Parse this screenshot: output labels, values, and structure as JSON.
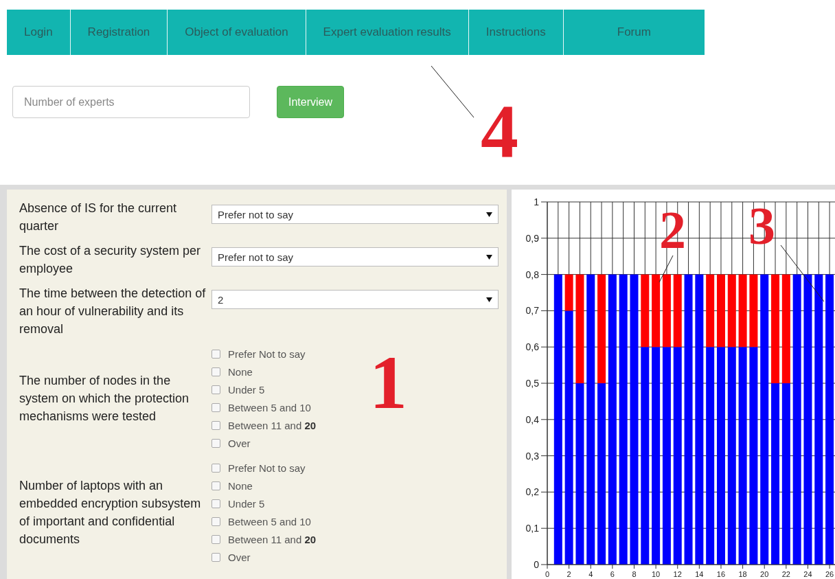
{
  "nav": {
    "tabs": [
      {
        "label": "Login",
        "selected": false
      },
      {
        "label": "Registration",
        "selected": false
      },
      {
        "label": "Object of evaluation",
        "selected": false
      },
      {
        "label": "Expert evaluation results",
        "selected": false
      },
      {
        "label": "Instructions",
        "selected": false
      },
      {
        "label": "Forum",
        "selected": false
      }
    ]
  },
  "experts_field": {
    "placeholder": "Number of experts"
  },
  "interview_button": {
    "label": "Interview"
  },
  "questions": [
    {
      "kind": "select",
      "label": "Absence of IS for the current quarter",
      "value": "Prefer not to say"
    },
    {
      "kind": "select",
      "label": "The cost of a security system per employee",
      "value": "Prefer not to say"
    },
    {
      "kind": "select",
      "label": "The time between the detection of an hour of vulnerability and its removal",
      "value": "2"
    },
    {
      "kind": "checkboxes",
      "label": "The number of nodes in the system on which the protection mechanisms were tested",
      "options": [
        {
          "label": "Prefer Not to say",
          "checked": false
        },
        {
          "label": "None",
          "checked": false
        },
        {
          "label": "Under 5",
          "checked": false
        },
        {
          "label": "Between 5 and 10",
          "checked": false
        },
        {
          "label": "Between 11 and **20**",
          "checked": false
        },
        {
          "label": "Over",
          "checked": false
        }
      ]
    },
    {
      "kind": "checkboxes",
      "label": "Number of laptops with an embedded encryption subsystem of important and confidential documents",
      "options": [
        {
          "label": "Prefer Not to say",
          "checked": false
        },
        {
          "label": "None",
          "checked": false
        },
        {
          "label": "Under 5",
          "checked": false
        },
        {
          "label": "Between 5 and 10",
          "checked": false
        },
        {
          "label": "Between 11 and **20**",
          "checked": false
        },
        {
          "label": "Over",
          "checked": false
        }
      ]
    }
  ],
  "results_chart": {
    "chart_data": {
      "type": "bar",
      "stacked": true,
      "grid": true,
      "x": [
        1,
        2,
        3,
        4,
        5,
        6,
        7,
        8,
        9,
        10,
        11,
        12,
        13,
        14,
        15,
        16,
        17,
        18,
        19,
        20,
        21,
        22,
        23,
        24,
        25,
        26
      ],
      "series": [
        {
          "color": "#0000ff",
          "values": [
            0.8,
            0.7,
            0.5,
            0.8,
            0.5,
            0.8,
            0.8,
            0.8,
            0.6,
            0.6,
            0.6,
            0.6,
            0.8,
            0.8,
            0.6,
            0.6,
            0.6,
            0.6,
            0.6,
            0.8,
            0.5,
            0.5,
            0.8,
            0.8,
            0.8,
            0.8
          ]
        },
        {
          "color": "#ff0000",
          "values": [
            0,
            0.1,
            0.3,
            0,
            0.3,
            0,
            0,
            0,
            0.2,
            0.2,
            0.2,
            0.2,
            0,
            0,
            0.2,
            0.2,
            0.2,
            0.2,
            0.2,
            0,
            0.3,
            0.3,
            0,
            0,
            0,
            0
          ]
        }
      ],
      "xlim": [
        0,
        26.5
      ],
      "ylim": [
        0,
        1
      ],
      "xticks": [
        0,
        2,
        4,
        6,
        8,
        10,
        12,
        14,
        16,
        18,
        20,
        22,
        24,
        26
      ],
      "yticks": [
        {
          "value": 0,
          "label": "0"
        },
        {
          "value": 0.1,
          "label": "0,1"
        },
        {
          "value": 0.2,
          "label": "0,2"
        },
        {
          "value": 0.3,
          "label": "0,3"
        },
        {
          "value": 0.4,
          "label": "0,4"
        },
        {
          "value": 0.5,
          "label": "0,5"
        },
        {
          "value": 0.6,
          "label": "0,6"
        },
        {
          "value": 0.7,
          "label": "0,7"
        },
        {
          "value": 0.8,
          "label": "0,8"
        },
        {
          "value": 0.9,
          "label": "0,9"
        },
        {
          "value": 1,
          "label": "1"
        }
      ]
    }
  },
  "callouts": [
    {
      "label": "4"
    },
    {
      "label": "2"
    },
    {
      "label": "3"
    },
    {
      "label": "1"
    }
  ]
}
